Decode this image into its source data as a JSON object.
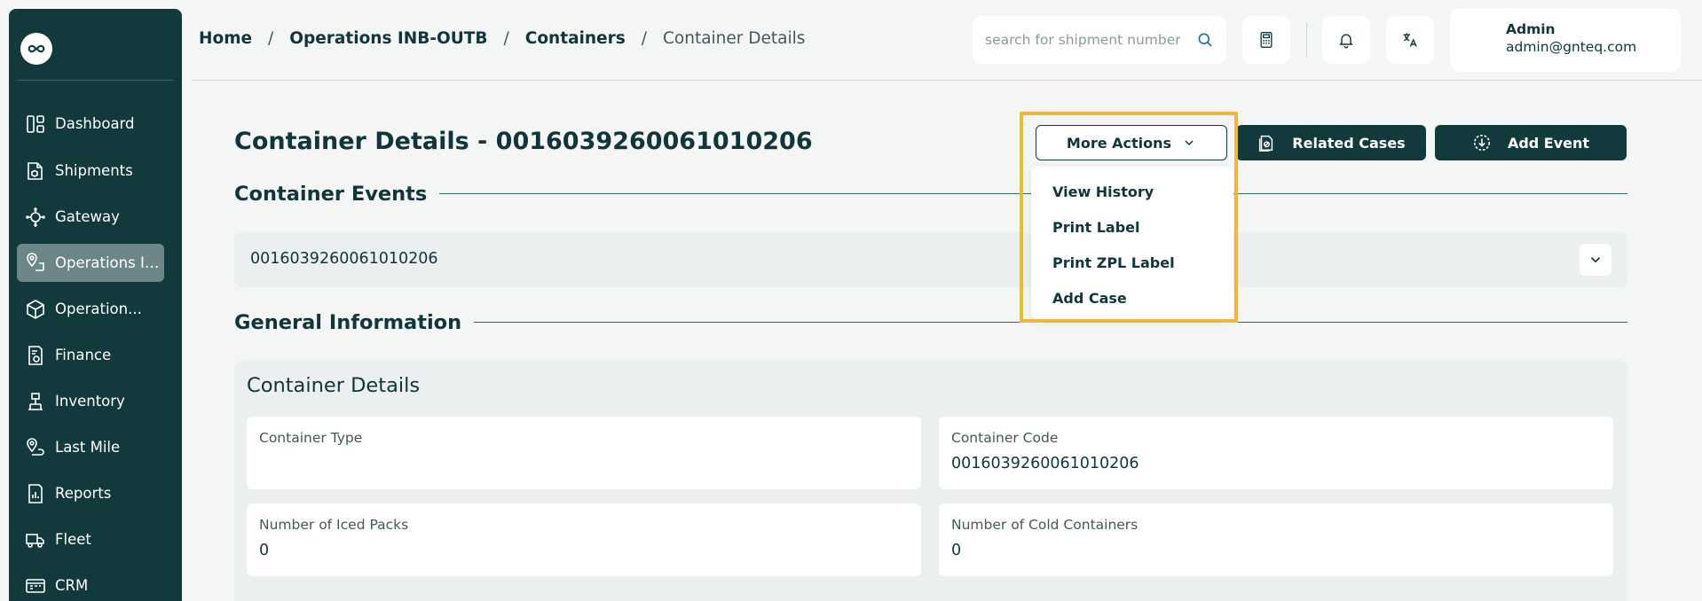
{
  "sidebar": {
    "items": [
      {
        "label": "Dashboard",
        "icon": "dashboard-icon"
      },
      {
        "label": "Shipments",
        "icon": "shipments-icon"
      },
      {
        "label": "Gateway",
        "icon": "gateway-icon"
      },
      {
        "label": "Operations IN...",
        "icon": "operations-location-icon",
        "active": true
      },
      {
        "label": "Operation...",
        "icon": "operations-box-icon"
      },
      {
        "label": "Finance",
        "icon": "finance-icon"
      },
      {
        "label": "Inventory",
        "icon": "inventory-icon"
      },
      {
        "label": "Last Mile",
        "icon": "last-mile-icon"
      },
      {
        "label": "Reports",
        "icon": "reports-icon"
      },
      {
        "label": "Fleet",
        "icon": "fleet-icon"
      },
      {
        "label": "CRM",
        "icon": "crm-icon"
      }
    ]
  },
  "header": {
    "breadcrumb": [
      "Home",
      "Operations INB-OUTB",
      "Containers",
      "Container Details"
    ],
    "separator": "/",
    "search_placeholder": "search for shipment number",
    "user": {
      "name": "Admin",
      "email": "admin@gnteq.com"
    }
  },
  "page": {
    "title": "Container Details - 0016039260061010206",
    "more_actions_label": "More Actions",
    "related_cases_label": "Related Cases",
    "add_event_label": "Add Event",
    "dropdown_items": [
      "View History",
      "Print Label",
      "Print ZPL Label",
      "Add Case"
    ]
  },
  "events": {
    "section_title": "Container Events",
    "item_value": "0016039260061010206"
  },
  "general": {
    "section_title": "General Information",
    "panel_title": "Container Details",
    "fields": [
      {
        "label": "Container Type",
        "value": ""
      },
      {
        "label": "Container Code",
        "value": "0016039260061010206"
      },
      {
        "label": "Number of Iced Packs",
        "value": "0"
      },
      {
        "label": "Number of Cold Containers",
        "value": "0"
      }
    ]
  },
  "colors": {
    "sidebar_bg": "#123a3d",
    "accent_dark": "#123a3d",
    "highlight": "#efb640",
    "page_bg": "#f4f6f6"
  }
}
